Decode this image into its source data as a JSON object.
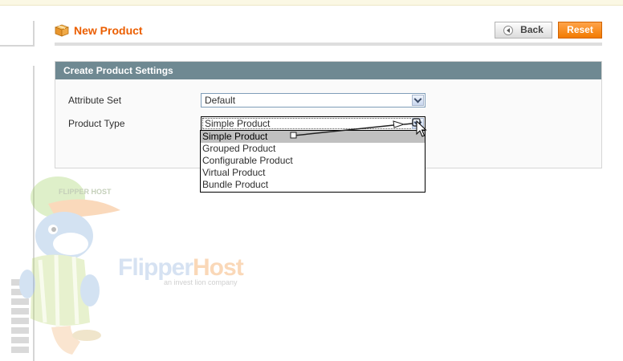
{
  "page": {
    "title": "New Product"
  },
  "toolbar": {
    "back_label": "Back",
    "reset_label": "Reset"
  },
  "settings": {
    "header": "Create Product Settings",
    "attribute_set": {
      "label": "Attribute Set",
      "value": "Default"
    },
    "product_type": {
      "label": "Product Type",
      "value": "Simple Product",
      "options": [
        "Simple Product",
        "Grouped Product",
        "Configurable Product",
        "Virtual Product",
        "Bundle Product"
      ],
      "highlighted": "Simple Product"
    }
  },
  "watermark": {
    "logo_part1": "Flipper",
    "logo_part2": "Host",
    "tagline": "an invest lion company",
    "cap_text": "FLIPPER HOST"
  },
  "colors": {
    "title": "#eb5e00",
    "reset_button": "#f27b00",
    "section_header": "#6f8992",
    "selected_option": "#c0c0c0"
  }
}
